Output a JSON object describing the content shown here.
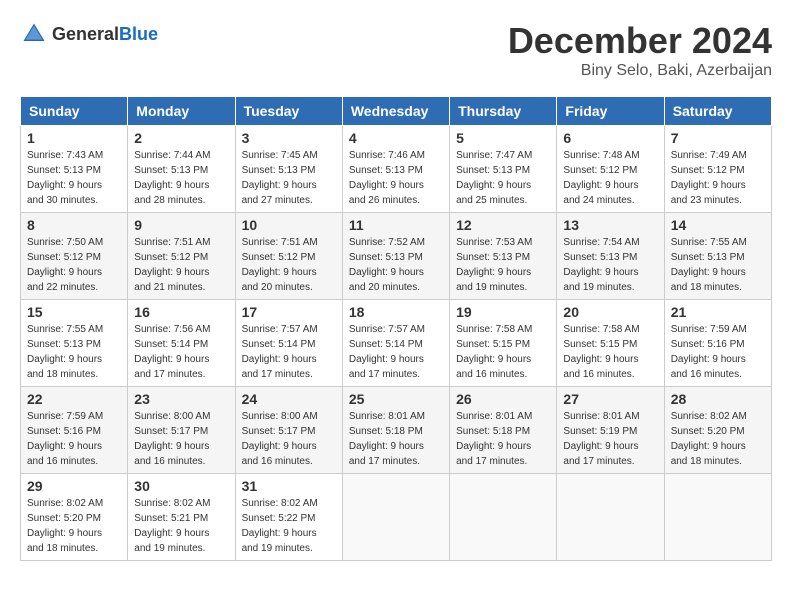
{
  "header": {
    "logo_general": "General",
    "logo_blue": "Blue",
    "title": "December 2024",
    "subtitle": "Biny Selo, Baki, Azerbaijan"
  },
  "weekdays": [
    "Sunday",
    "Monday",
    "Tuesday",
    "Wednesday",
    "Thursday",
    "Friday",
    "Saturday"
  ],
  "weeks": [
    [
      {
        "day": "1",
        "sunrise": "7:43 AM",
        "sunset": "5:13 PM",
        "daylight": "9 hours and 30 minutes."
      },
      {
        "day": "2",
        "sunrise": "7:44 AM",
        "sunset": "5:13 PM",
        "daylight": "9 hours and 28 minutes."
      },
      {
        "day": "3",
        "sunrise": "7:45 AM",
        "sunset": "5:13 PM",
        "daylight": "9 hours and 27 minutes."
      },
      {
        "day": "4",
        "sunrise": "7:46 AM",
        "sunset": "5:13 PM",
        "daylight": "9 hours and 26 minutes."
      },
      {
        "day": "5",
        "sunrise": "7:47 AM",
        "sunset": "5:13 PM",
        "daylight": "9 hours and 25 minutes."
      },
      {
        "day": "6",
        "sunrise": "7:48 AM",
        "sunset": "5:12 PM",
        "daylight": "9 hours and 24 minutes."
      },
      {
        "day": "7",
        "sunrise": "7:49 AM",
        "sunset": "5:12 PM",
        "daylight": "9 hours and 23 minutes."
      }
    ],
    [
      {
        "day": "8",
        "sunrise": "7:50 AM",
        "sunset": "5:12 PM",
        "daylight": "9 hours and 22 minutes."
      },
      {
        "day": "9",
        "sunrise": "7:51 AM",
        "sunset": "5:12 PM",
        "daylight": "9 hours and 21 minutes."
      },
      {
        "day": "10",
        "sunrise": "7:51 AM",
        "sunset": "5:12 PM",
        "daylight": "9 hours and 20 minutes."
      },
      {
        "day": "11",
        "sunrise": "7:52 AM",
        "sunset": "5:13 PM",
        "daylight": "9 hours and 20 minutes."
      },
      {
        "day": "12",
        "sunrise": "7:53 AM",
        "sunset": "5:13 PM",
        "daylight": "9 hours and 19 minutes."
      },
      {
        "day": "13",
        "sunrise": "7:54 AM",
        "sunset": "5:13 PM",
        "daylight": "9 hours and 19 minutes."
      },
      {
        "day": "14",
        "sunrise": "7:55 AM",
        "sunset": "5:13 PM",
        "daylight": "9 hours and 18 minutes."
      }
    ],
    [
      {
        "day": "15",
        "sunrise": "7:55 AM",
        "sunset": "5:13 PM",
        "daylight": "9 hours and 18 minutes."
      },
      {
        "day": "16",
        "sunrise": "7:56 AM",
        "sunset": "5:14 PM",
        "daylight": "9 hours and 17 minutes."
      },
      {
        "day": "17",
        "sunrise": "7:57 AM",
        "sunset": "5:14 PM",
        "daylight": "9 hours and 17 minutes."
      },
      {
        "day": "18",
        "sunrise": "7:57 AM",
        "sunset": "5:14 PM",
        "daylight": "9 hours and 17 minutes."
      },
      {
        "day": "19",
        "sunrise": "7:58 AM",
        "sunset": "5:15 PM",
        "daylight": "9 hours and 16 minutes."
      },
      {
        "day": "20",
        "sunrise": "7:58 AM",
        "sunset": "5:15 PM",
        "daylight": "9 hours and 16 minutes."
      },
      {
        "day": "21",
        "sunrise": "7:59 AM",
        "sunset": "5:16 PM",
        "daylight": "9 hours and 16 minutes."
      }
    ],
    [
      {
        "day": "22",
        "sunrise": "7:59 AM",
        "sunset": "5:16 PM",
        "daylight": "9 hours and 16 minutes."
      },
      {
        "day": "23",
        "sunrise": "8:00 AM",
        "sunset": "5:17 PM",
        "daylight": "9 hours and 16 minutes."
      },
      {
        "day": "24",
        "sunrise": "8:00 AM",
        "sunset": "5:17 PM",
        "daylight": "9 hours and 16 minutes."
      },
      {
        "day": "25",
        "sunrise": "8:01 AM",
        "sunset": "5:18 PM",
        "daylight": "9 hours and 17 minutes."
      },
      {
        "day": "26",
        "sunrise": "8:01 AM",
        "sunset": "5:18 PM",
        "daylight": "9 hours and 17 minutes."
      },
      {
        "day": "27",
        "sunrise": "8:01 AM",
        "sunset": "5:19 PM",
        "daylight": "9 hours and 17 minutes."
      },
      {
        "day": "28",
        "sunrise": "8:02 AM",
        "sunset": "5:20 PM",
        "daylight": "9 hours and 18 minutes."
      }
    ],
    [
      {
        "day": "29",
        "sunrise": "8:02 AM",
        "sunset": "5:20 PM",
        "daylight": "9 hours and 18 minutes."
      },
      {
        "day": "30",
        "sunrise": "8:02 AM",
        "sunset": "5:21 PM",
        "daylight": "9 hours and 19 minutes."
      },
      {
        "day": "31",
        "sunrise": "8:02 AM",
        "sunset": "5:22 PM",
        "daylight": "9 hours and 19 minutes."
      },
      null,
      null,
      null,
      null
    ]
  ]
}
